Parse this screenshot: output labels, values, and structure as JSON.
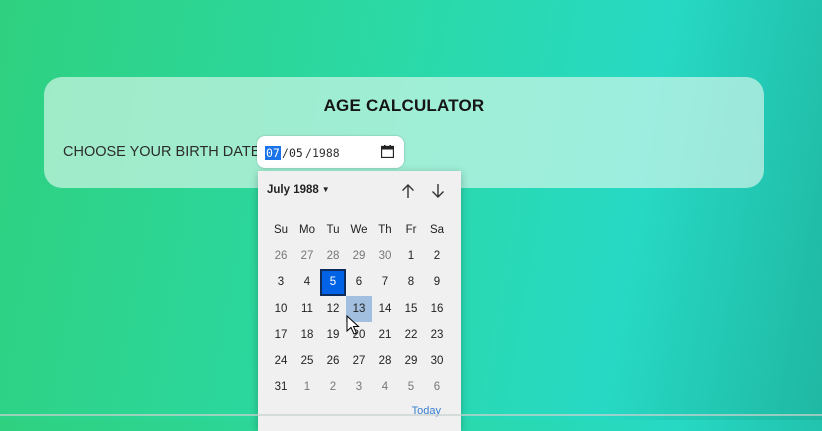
{
  "app": {
    "title": "AGE CALCULATOR",
    "birth_label": "CHOOSE YOUR BIRTH DATE"
  },
  "date_input": {
    "month": "07",
    "sep1": "/",
    "day": "05",
    "sep2": "/",
    "year": "1988",
    "calendar_icon": "calendar-icon"
  },
  "picker": {
    "month_label": "July 1988",
    "caret_icon": "caret-down-icon",
    "prev_icon": "arrow-up-icon",
    "next_icon": "arrow-down-icon",
    "weekdays": [
      "Su",
      "Mo",
      "Tu",
      "We",
      "Th",
      "Fr",
      "Sa"
    ],
    "days": [
      "26",
      "27",
      "28",
      "29",
      "30",
      "1",
      "2",
      "3",
      "4",
      "5",
      "6",
      "7",
      "8",
      "9",
      "10",
      "11",
      "12",
      "13",
      "14",
      "15",
      "16",
      "17",
      "18",
      "19",
      "20",
      "21",
      "22",
      "23",
      "24",
      "25",
      "26",
      "27",
      "28",
      "29",
      "30",
      "31",
      "1",
      "2",
      "3",
      "4",
      "5",
      "6"
    ],
    "selected_day": "5",
    "hovered_day": "13",
    "today_label": "Today",
    "colors": {
      "selected": "#0063e6",
      "hover": "#a3bfe0",
      "today_link": "#3a7ecf"
    }
  }
}
